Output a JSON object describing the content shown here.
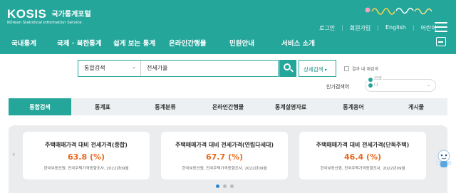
{
  "header": {
    "logo": "KOSIS",
    "logo_kr": "국가통계포털",
    "logo_en": "KOrean Statistical Information Service",
    "util_links": [
      "로그인",
      "회원가입",
      "English",
      "어린이"
    ],
    "nav": [
      "국내통계",
      "국제 · 북한통계",
      "쉽게 보는 통계",
      "온라인간행물",
      "민원안내",
      "서비스 소개"
    ],
    "colors": {
      "brand": "#24a69b"
    }
  },
  "search": {
    "scope": "통합검색",
    "query": "전세가율",
    "detail_label": "상세검색",
    "within_label": "결과 내 재검색",
    "popular_label": "인기검색어",
    "popular_top": "코로나",
    "popular_item": ""
  },
  "tabs": [
    "통합검색",
    "통계표",
    "통계분류",
    "온라인간행물",
    "통계설명자료",
    "통계용어",
    "게시물"
  ],
  "cards": [
    {
      "title": "주택매매가격 대비 전세가격(종합)",
      "value": "63.8 (%)",
      "source": "한국부동산원, 전국주택가격동향조사, 2022년09월"
    },
    {
      "title": "주택매매가격 대비 전세가격(연립다세대)",
      "value": "67.7 (%)",
      "source": "한국부동산원, 전국주택가격동향조사, 2022년09월"
    },
    {
      "title": "주택매매가격 대비 전세가격(단독주택)",
      "value": "46.4 (%)",
      "source": "한국부동산원, 전국주택가격동향조사, 2022년09월"
    }
  ],
  "carousel": {
    "prev": "‹",
    "page_count": 3,
    "current_page": 1
  }
}
